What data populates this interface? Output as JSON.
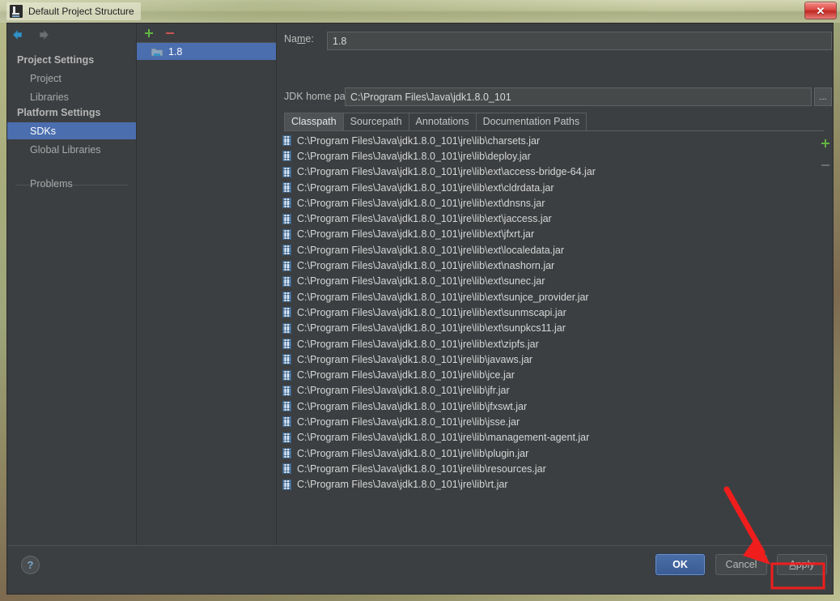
{
  "window": {
    "title": "Default Project Structure",
    "app_icon": "intellij-idea-icon",
    "close_label": "✕"
  },
  "sidebar": {
    "back_icon": "back-arrow-icon",
    "forward_icon": "forward-arrow-icon",
    "groups": [
      {
        "header": "Project Settings",
        "items": [
          {
            "label": "Project",
            "selected": false
          },
          {
            "label": "Libraries",
            "selected": false
          }
        ]
      },
      {
        "header": "Platform Settings",
        "items": [
          {
            "label": "SDKs",
            "selected": true
          },
          {
            "label": "Global Libraries",
            "selected": false
          }
        ]
      }
    ],
    "problems_label": "Problems"
  },
  "sdk_panel": {
    "add_label": "+",
    "remove_label": "−",
    "items": [
      {
        "label": "1.8",
        "selected": true,
        "icon": "jdk-folder-icon"
      }
    ]
  },
  "detail": {
    "name_label_pre": "Na",
    "name_label_mnemonic": "m",
    "name_label_post": "e:",
    "name_label": "Name:",
    "name_value": "1.8",
    "jdk_home_label": "JDK home path:",
    "jdk_home_value": "C:\\Program Files\\Java\\jdk1.8.0_101",
    "browse_label": "...",
    "tabs": [
      {
        "label": "Classpath",
        "active": true
      },
      {
        "label": "Sourcepath",
        "active": false
      },
      {
        "label": "Annotations",
        "active": false
      },
      {
        "label": "Documentation Paths",
        "active": false
      }
    ],
    "classpath_add_label": "+",
    "classpath_remove_label": "−",
    "classpath_entries": [
      "C:\\Program Files\\Java\\jdk1.8.0_101\\jre\\lib\\charsets.jar",
      "C:\\Program Files\\Java\\jdk1.8.0_101\\jre\\lib\\deploy.jar",
      "C:\\Program Files\\Java\\jdk1.8.0_101\\jre\\lib\\ext\\access-bridge-64.jar",
      "C:\\Program Files\\Java\\jdk1.8.0_101\\jre\\lib\\ext\\cldrdata.jar",
      "C:\\Program Files\\Java\\jdk1.8.0_101\\jre\\lib\\ext\\dnsns.jar",
      "C:\\Program Files\\Java\\jdk1.8.0_101\\jre\\lib\\ext\\jaccess.jar",
      "C:\\Program Files\\Java\\jdk1.8.0_101\\jre\\lib\\ext\\jfxrt.jar",
      "C:\\Program Files\\Java\\jdk1.8.0_101\\jre\\lib\\ext\\localedata.jar",
      "C:\\Program Files\\Java\\jdk1.8.0_101\\jre\\lib\\ext\\nashorn.jar",
      "C:\\Program Files\\Java\\jdk1.8.0_101\\jre\\lib\\ext\\sunec.jar",
      "C:\\Program Files\\Java\\jdk1.8.0_101\\jre\\lib\\ext\\sunjce_provider.jar",
      "C:\\Program Files\\Java\\jdk1.8.0_101\\jre\\lib\\ext\\sunmscapi.jar",
      "C:\\Program Files\\Java\\jdk1.8.0_101\\jre\\lib\\ext\\sunpkcs11.jar",
      "C:\\Program Files\\Java\\jdk1.8.0_101\\jre\\lib\\ext\\zipfs.jar",
      "C:\\Program Files\\Java\\jdk1.8.0_101\\jre\\lib\\javaws.jar",
      "C:\\Program Files\\Java\\jdk1.8.0_101\\jre\\lib\\jce.jar",
      "C:\\Program Files\\Java\\jdk1.8.0_101\\jre\\lib\\jfr.jar",
      "C:\\Program Files\\Java\\jdk1.8.0_101\\jre\\lib\\jfxswt.jar",
      "C:\\Program Files\\Java\\jdk1.8.0_101\\jre\\lib\\jsse.jar",
      "C:\\Program Files\\Java\\jdk1.8.0_101\\jre\\lib\\management-agent.jar",
      "C:\\Program Files\\Java\\jdk1.8.0_101\\jre\\lib\\plugin.jar",
      "C:\\Program Files\\Java\\jdk1.8.0_101\\jre\\lib\\resources.jar",
      "C:\\Program Files\\Java\\jdk1.8.0_101\\jre\\lib\\rt.jar"
    ]
  },
  "bottom_bar": {
    "help_label": "?",
    "ok_label": "OK",
    "cancel_label": "Cancel",
    "apply_label": "Apply",
    "apply_mnemonic": "A",
    "apply_rest": "pply"
  },
  "annotation": {
    "arrow_color": "#f01d1d",
    "highlight_color": "#f01d1d",
    "description": "red arrow pointing at the Apply button with a red highlight box"
  },
  "colors": {
    "accent_selection": "#4b6eaf",
    "panel_bg": "#3c3f41",
    "input_bg": "#45494a",
    "text": "#bbbbbb",
    "title_bar": "#c4c89e",
    "close_red": "#d8453f"
  }
}
